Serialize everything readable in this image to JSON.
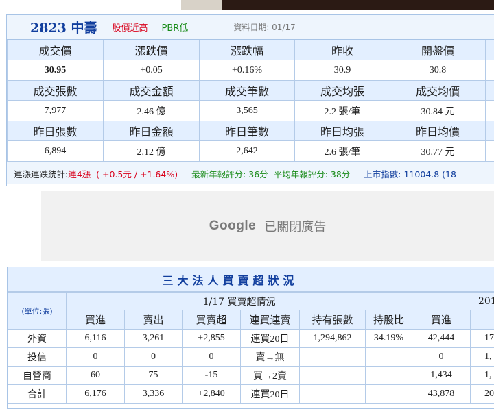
{
  "stock": {
    "title": "2823 中壽",
    "tag_red": "股價近高",
    "tag_green": "PBR低",
    "data_date": "資料日期: 01/17"
  },
  "quote": {
    "row1_labels": [
      "成交價",
      "漲跌價",
      "漲跌幅",
      "昨收",
      "開盤價"
    ],
    "row1_values": [
      "30.95",
      "+0.05",
      "+0.16%",
      "30.9",
      "30.8"
    ],
    "row2_labels": [
      "成交張數",
      "成交金額",
      "成交筆數",
      "成交均張",
      "成交均價"
    ],
    "row2_values": [
      "7,977",
      "2.46 億",
      "3,565",
      "2.2 張/筆",
      "30.84 元"
    ],
    "row3_labels": [
      "昨日張數",
      "昨日金額",
      "昨日筆數",
      "昨日均張",
      "昨日均價"
    ],
    "row3_values": [
      "6,894",
      "2.12 億",
      "2,642",
      "2.6 張/筆",
      "30.77 元"
    ]
  },
  "stats": {
    "label": "連漲連跌統計:",
    "streak": "連4漲",
    "change": "( +0.5元 / +1.64%)",
    "latest_score": "最新年報評分: 36分",
    "avg_score": "平均年報評分: 38分",
    "index": "上市指數: 11004.8 (18"
  },
  "ad": {
    "brand": "Google",
    "text": "已關閉廣告"
  },
  "institutional": {
    "title": "三大法人買賣超狀況",
    "unit": "(單位:張)",
    "period_label": "1/17 買賣超情況",
    "period2_label": "201",
    "columns": [
      "買進",
      "賣出",
      "買賣超",
      "連買連賣",
      "持有張數",
      "持股比",
      "買進",
      "賣"
    ],
    "rows": [
      {
        "name": "外資",
        "buy": "6,116",
        "sell": "3,261",
        "net": "+2,855",
        "streak": "連買20日",
        "holding": "1,294,862",
        "ratio": "34.19%",
        "buy2": "42,444",
        "sell2": "17"
      },
      {
        "name": "投信",
        "buy": "0",
        "sell": "0",
        "net": "0",
        "streak": "賣→無",
        "holding": "",
        "ratio": "",
        "buy2": "0",
        "sell2": "1,"
      },
      {
        "name": "自營商",
        "buy": "60",
        "sell": "75",
        "net": "-15",
        "streak": "買→2賣",
        "holding": "",
        "ratio": "",
        "buy2": "1,434",
        "sell2": "1,"
      },
      {
        "name": "合計",
        "buy": "6,176",
        "sell": "3,336",
        "net": "+2,840",
        "streak": "連買20日",
        "holding": "",
        "ratio": "",
        "buy2": "43,878",
        "sell2": "20"
      }
    ]
  },
  "colors": {
    "up_red": "#d9001b",
    "down_green": "#178a17",
    "title_blue": "#123f9e",
    "header_bg": "#e3efff"
  }
}
